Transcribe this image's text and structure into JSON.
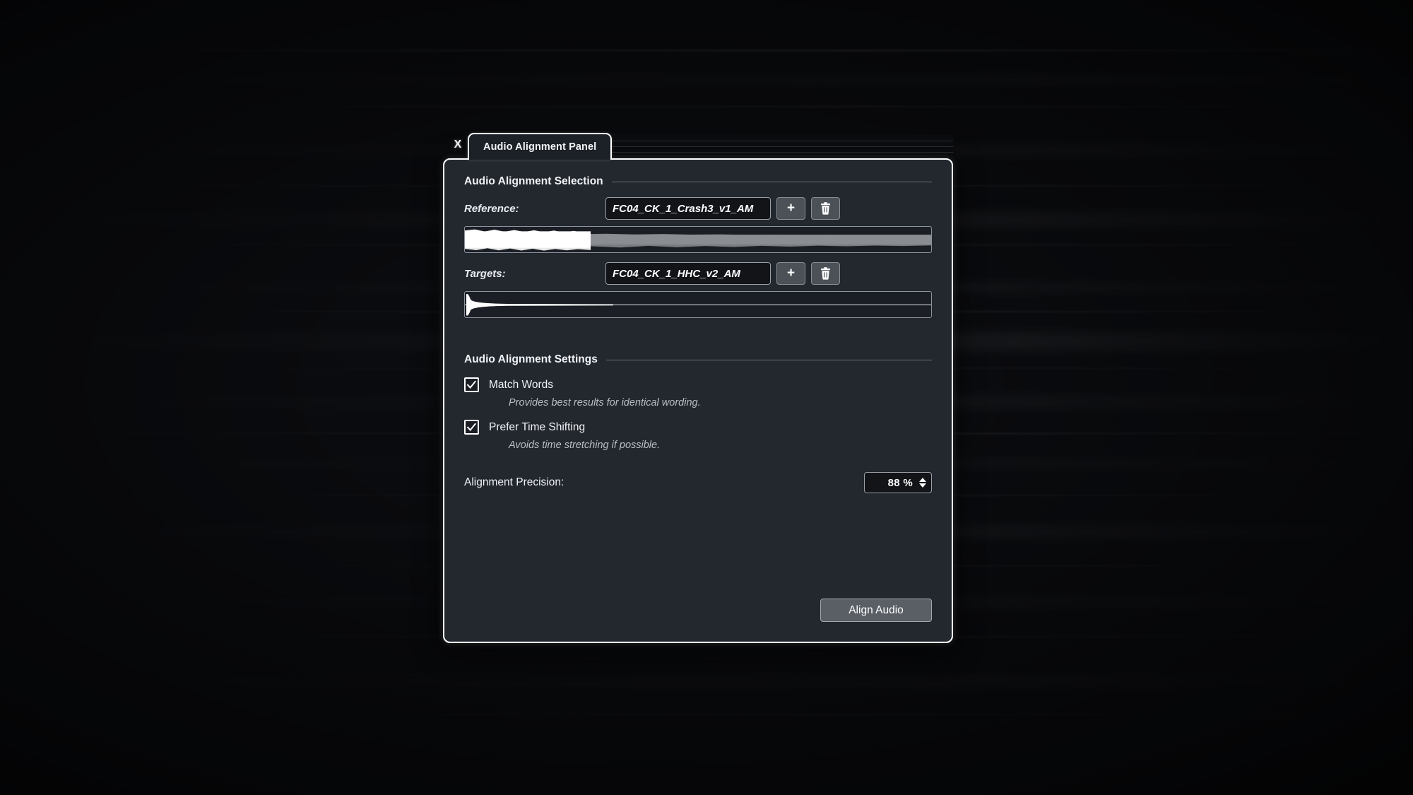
{
  "window": {
    "close_label": "X",
    "tab_label": "Audio Alignment Panel"
  },
  "selection": {
    "group_title": "Audio Alignment Selection",
    "reference": {
      "label": "Reference:",
      "value": "FC04_CK_1_Crash3_v1_AM",
      "add_label": "+"
    },
    "targets": {
      "label": "Targets:",
      "value": "FC04_CK_1_HHC_v2_AM",
      "add_label": "+"
    }
  },
  "settings": {
    "group_title": "Audio Alignment Settings",
    "match_words": {
      "label": "Match Words",
      "hint": "Provides best results for identical wording.",
      "checked": true
    },
    "prefer_time_shifting": {
      "label": "Prefer Time Shifting",
      "hint": "Avoids time stretching if possible.",
      "checked": true
    },
    "precision": {
      "label": "Alignment Precision:",
      "value": "88 %"
    }
  },
  "actions": {
    "align_label": "Align Audio"
  },
  "colors": {
    "panel_bg": "#23282f",
    "panel_border": "#ffffff",
    "field_bg": "#121418",
    "button_bg": "#5a5f66",
    "waveform_selected": "#ffffff",
    "waveform_unselected": "#8a8d91",
    "text": "#f0f2f5"
  }
}
